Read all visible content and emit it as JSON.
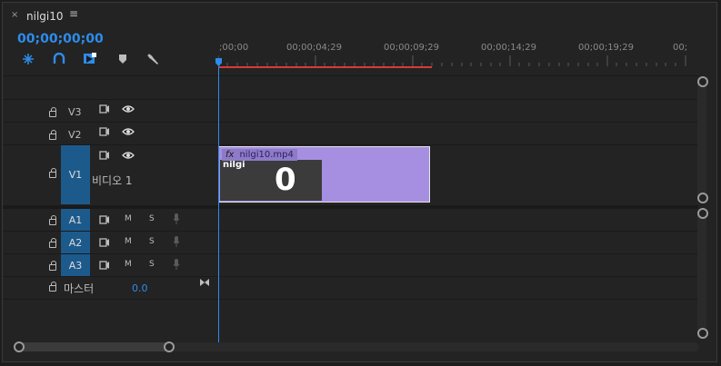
{
  "panel": {
    "title": "nilgi10",
    "close_glyph": "×",
    "menu_glyph": "≡"
  },
  "timecode": "00;00;00;00",
  "tools": [
    {
      "name": "snap-icon"
    },
    {
      "name": "linked-selection-icon"
    },
    {
      "name": "add-marker-icon"
    },
    {
      "name": "marker-icon"
    },
    {
      "name": "wrench-icon"
    }
  ],
  "ruler": {
    "labels": [
      ";00;00",
      "00;00;04;29",
      "00;00;09;29",
      "00;00;14;29",
      "00;00;19;29",
      "00;"
    ]
  },
  "tracks": {
    "video": [
      {
        "target": "",
        "name": "V3"
      },
      {
        "target": "",
        "name": "V2"
      },
      {
        "target": "V1",
        "name": "비디오 1"
      }
    ],
    "audio": [
      {
        "target": "A1",
        "m": "M",
        "s": "S"
      },
      {
        "target": "A2",
        "m": "M",
        "s": "S"
      },
      {
        "target": "A3",
        "m": "M",
        "s": "S"
      }
    ],
    "master": {
      "name": "마스터",
      "value": "0.0"
    }
  },
  "clip": {
    "fx": "fx",
    "name": "nilgi10.mp4",
    "thumb_text": "nilgi",
    "thumb_digit": "0"
  },
  "colors": {
    "accent": "#2d8ceb",
    "clip": "#a68fe0",
    "work_area": "#d83a3a",
    "target": "#1d5a8c"
  }
}
